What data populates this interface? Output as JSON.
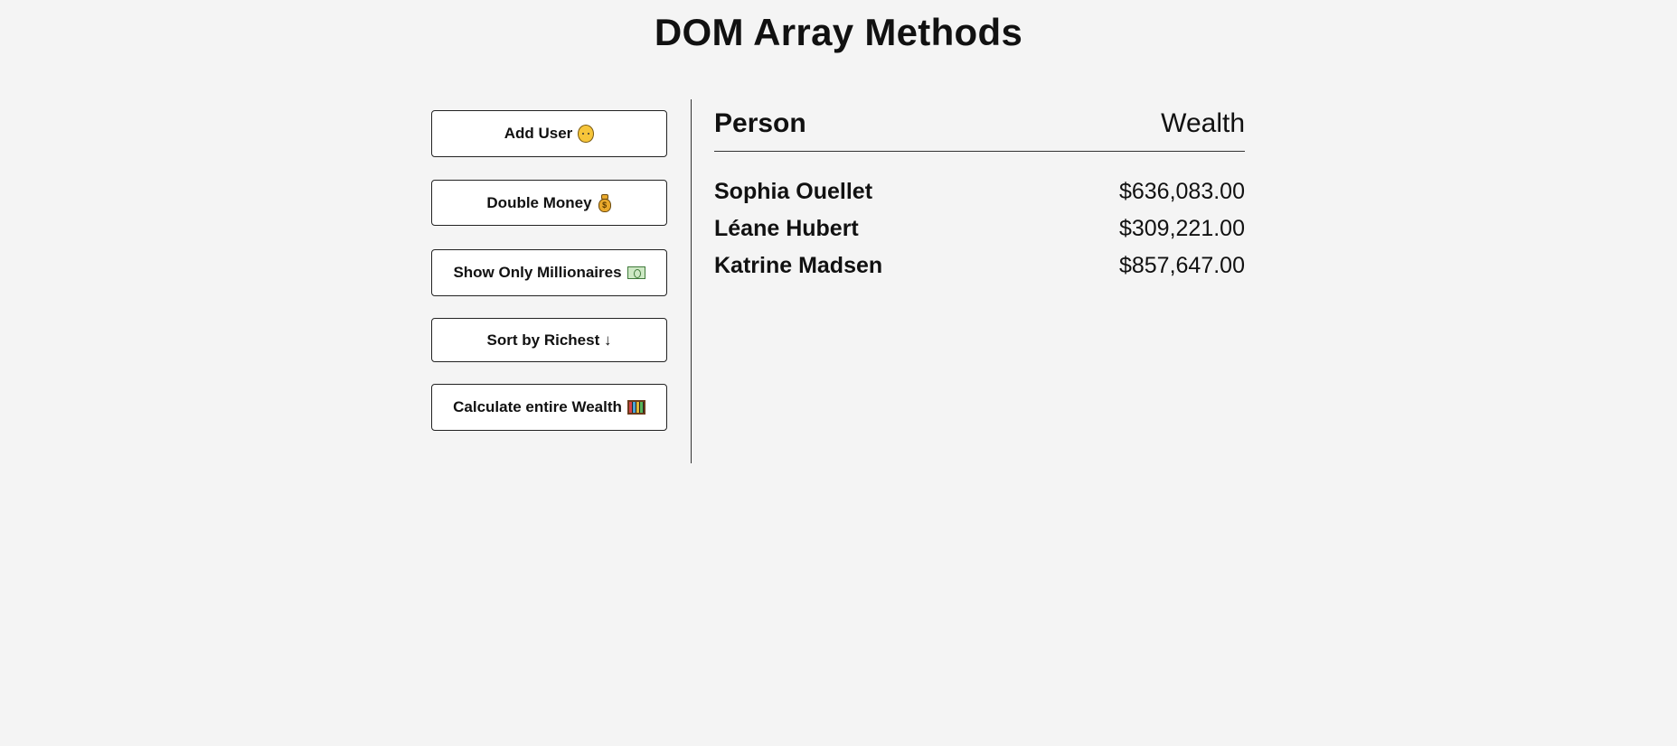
{
  "page": {
    "title": "DOM Array Methods"
  },
  "controls": {
    "add_user": {
      "label": "Add User",
      "icon": "face-emoji-icon"
    },
    "double_money": {
      "label": "Double Money",
      "icon": "money-bag-icon"
    },
    "show_millionaires": {
      "label": "Show Only Millionaires",
      "icon": "dollar-bill-icon"
    },
    "sort_richest": {
      "label": "Sort by Richest ↓"
    },
    "calculate_wealth": {
      "label": "Calculate entire Wealth",
      "icon": "abacus-icon"
    }
  },
  "table": {
    "headers": {
      "person": "Person",
      "wealth": "Wealth"
    },
    "rows": [
      {
        "name": "Sophia Ouellet",
        "wealth": "$636,083.00"
      },
      {
        "name": "Léane Hubert",
        "wealth": "$309,221.00"
      },
      {
        "name": "Katrine Madsen",
        "wealth": "$857,647.00"
      }
    ]
  },
  "colors": {
    "background": "#f4f4f4",
    "button_bg": "#ffffff",
    "text": "#111111",
    "border": "#222222"
  }
}
